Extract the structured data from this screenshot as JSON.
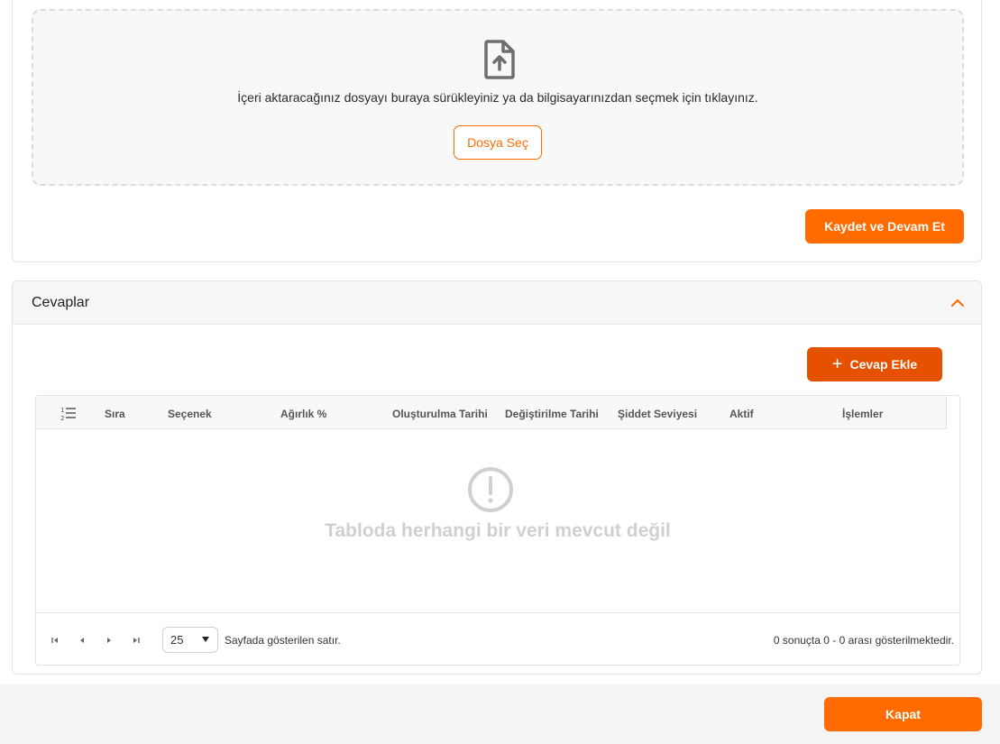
{
  "upload": {
    "icon": "file-upload-icon",
    "instruction": "İçeri aktaracağınız dosyayı buraya sürükleyiniz ya da bilgisayarınızdan seçmek için tıklayınız.",
    "choose_label": "Dosya Seç",
    "save_label": "Kaydet ve Devam Et"
  },
  "answers": {
    "title": "Cevaplar",
    "collapse_icon": "chevron-up-icon",
    "add_label": "Cevap Ekle",
    "table": {
      "order_icon": "list-ordered-icon",
      "columns": [
        "Sıra",
        "Seçenek",
        "Ağırlık %",
        "Oluşturulma Tarihi",
        "Değiştirilme Tarihi",
        "Şiddet Seviyesi",
        "Aktif",
        "İşlemler"
      ],
      "empty_icon": "exclamation-circle-icon",
      "empty_text": "Tabloda herhangi bir veri mevcut değil",
      "rows": []
    },
    "pagination": {
      "per_page": "25",
      "per_page_label": "Sayfada gösterilen satır.",
      "results_text": "0 sonuçta 0 - 0 arası gösterilmektedir."
    }
  },
  "footer": {
    "close_label": "Kapat"
  },
  "colors": {
    "accent": "#ff6b00",
    "accent_dark": "#e65100",
    "muted": "#d0d0d0"
  }
}
